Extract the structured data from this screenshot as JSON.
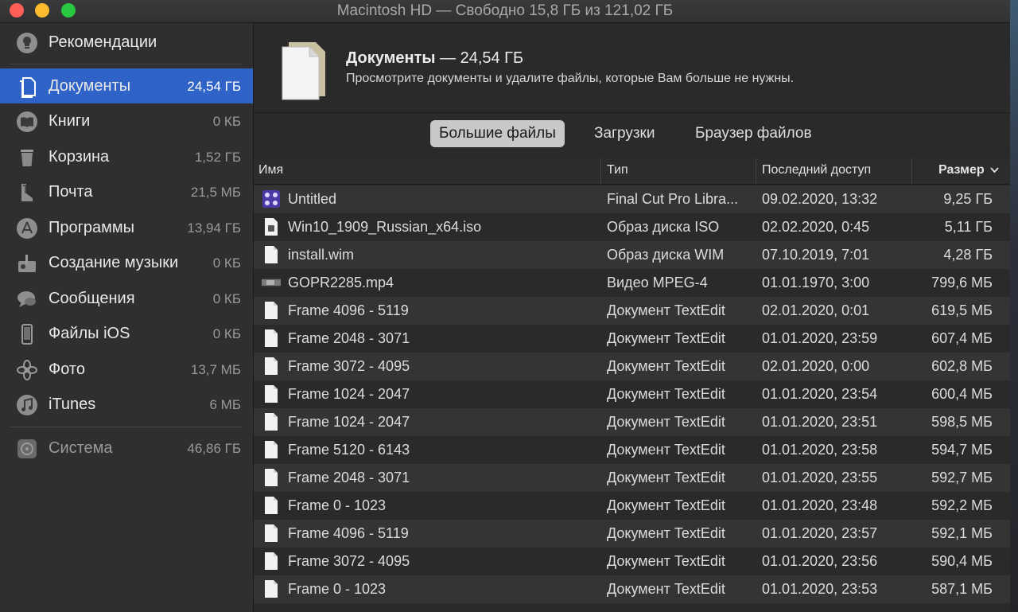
{
  "window": {
    "title": "Macintosh HD — Свободно 15,8 ГБ из 121,02 ГБ"
  },
  "sidebar": {
    "items": [
      {
        "label": "Рекомендации",
        "size": "",
        "icon": "lightbulb-icon"
      },
      {
        "label": "Документы",
        "size": "24,54 ГБ",
        "icon": "documents-icon"
      },
      {
        "label": "Книги",
        "size": "0 КБ",
        "icon": "book-icon"
      },
      {
        "label": "Корзина",
        "size": "1,52 ГБ",
        "icon": "trash-icon"
      },
      {
        "label": "Почта",
        "size": "21,5 МБ",
        "icon": "mail-icon"
      },
      {
        "label": "Программы",
        "size": "13,94 ГБ",
        "icon": "app-store-icon"
      },
      {
        "label": "Создание музыки",
        "size": "0 КБ",
        "icon": "music-creation-icon"
      },
      {
        "label": "Сообщения",
        "size": "0 КБ",
        "icon": "messages-icon"
      },
      {
        "label": "Файлы iOS",
        "size": "0 КБ",
        "icon": "iphone-icon"
      },
      {
        "label": "Фото",
        "size": "13,7 МБ",
        "icon": "photos-icon"
      },
      {
        "label": "iTunes",
        "size": "6 МБ",
        "icon": "itunes-icon"
      },
      {
        "label": "Система",
        "size": "46,86 ГБ",
        "icon": "system-gear-icon"
      }
    ]
  },
  "header": {
    "title": "Документы",
    "title_size": " — 24,54 ГБ",
    "subtitle": "Просмотрите документы и удалите файлы, которые Вам больше не нужны."
  },
  "tabs": [
    {
      "label": "Большие файлы",
      "active": true
    },
    {
      "label": "Загрузки",
      "active": false
    },
    {
      "label": "Браузер файлов",
      "active": false
    }
  ],
  "table": {
    "columns": [
      "Имя",
      "Тип",
      "Последний доступ",
      "Размер"
    ],
    "sorted_column": "Размер",
    "rows": [
      {
        "name": "Untitled",
        "type": "Final Cut Pro Libra...",
        "date": "09.02.2020, 13:32",
        "size": "9,25 ГБ",
        "icon": "fcp-library-icon"
      },
      {
        "name": "Win10_1909_Russian_x64.iso",
        "type": "Образ диска ISO",
        "date": "02.02.2020, 0:45",
        "size": "5,11 ГБ",
        "icon": "disk-image-icon"
      },
      {
        "name": "install.wim",
        "type": "Образ диска WIM",
        "date": "07.10.2019, 7:01",
        "size": "4,28 ГБ",
        "icon": "file-icon"
      },
      {
        "name": "GOPR2285.mp4",
        "type": "Видео MPEG-4",
        "date": "01.01.1970, 3:00",
        "size": "799,6 МБ",
        "icon": "video-thumbnail-icon"
      },
      {
        "name": "Frame 4096 - 5119",
        "type": "Документ TextEdit",
        "date": "02.01.2020, 0:01",
        "size": "619,5 МБ",
        "icon": "file-icon"
      },
      {
        "name": "Frame 2048 - 3071",
        "type": "Документ TextEdit",
        "date": "01.01.2020, 23:59",
        "size": "607,4 МБ",
        "icon": "file-icon"
      },
      {
        "name": "Frame 3072 - 4095",
        "type": "Документ TextEdit",
        "date": "02.01.2020, 0:00",
        "size": "602,8 МБ",
        "icon": "file-icon"
      },
      {
        "name": "Frame 1024 - 2047",
        "type": "Документ TextEdit",
        "date": "01.01.2020, 23:54",
        "size": "600,4 МБ",
        "icon": "file-icon"
      },
      {
        "name": "Frame 1024 - 2047",
        "type": "Документ TextEdit",
        "date": "01.01.2020, 23:51",
        "size": "598,5 МБ",
        "icon": "file-icon"
      },
      {
        "name": "Frame 5120 - 6143",
        "type": "Документ TextEdit",
        "date": "01.01.2020, 23:58",
        "size": "594,7 МБ",
        "icon": "file-icon"
      },
      {
        "name": "Frame 2048 - 3071",
        "type": "Документ TextEdit",
        "date": "01.01.2020, 23:55",
        "size": "592,7 МБ",
        "icon": "file-icon"
      },
      {
        "name": "Frame 0 - 1023",
        "type": "Документ TextEdit",
        "date": "01.01.2020, 23:48",
        "size": "592,2 МБ",
        "icon": "file-icon"
      },
      {
        "name": "Frame 4096 - 5119",
        "type": "Документ TextEdit",
        "date": "01.01.2020, 23:57",
        "size": "592,1 МБ",
        "icon": "file-icon"
      },
      {
        "name": "Frame 3072 - 4095",
        "type": "Документ TextEdit",
        "date": "01.01.2020, 23:56",
        "size": "590,4 МБ",
        "icon": "file-icon"
      },
      {
        "name": "Frame 0 - 1023",
        "type": "Документ TextEdit",
        "date": "01.01.2020, 23:53",
        "size": "587,1 МБ",
        "icon": "file-icon"
      }
    ]
  },
  "colors": {
    "selection": "#2f63c7",
    "sidebar_bg": "#2f2f31",
    "close": "#ff5f57",
    "minimize": "#febc2e",
    "maximize": "#28c840"
  }
}
